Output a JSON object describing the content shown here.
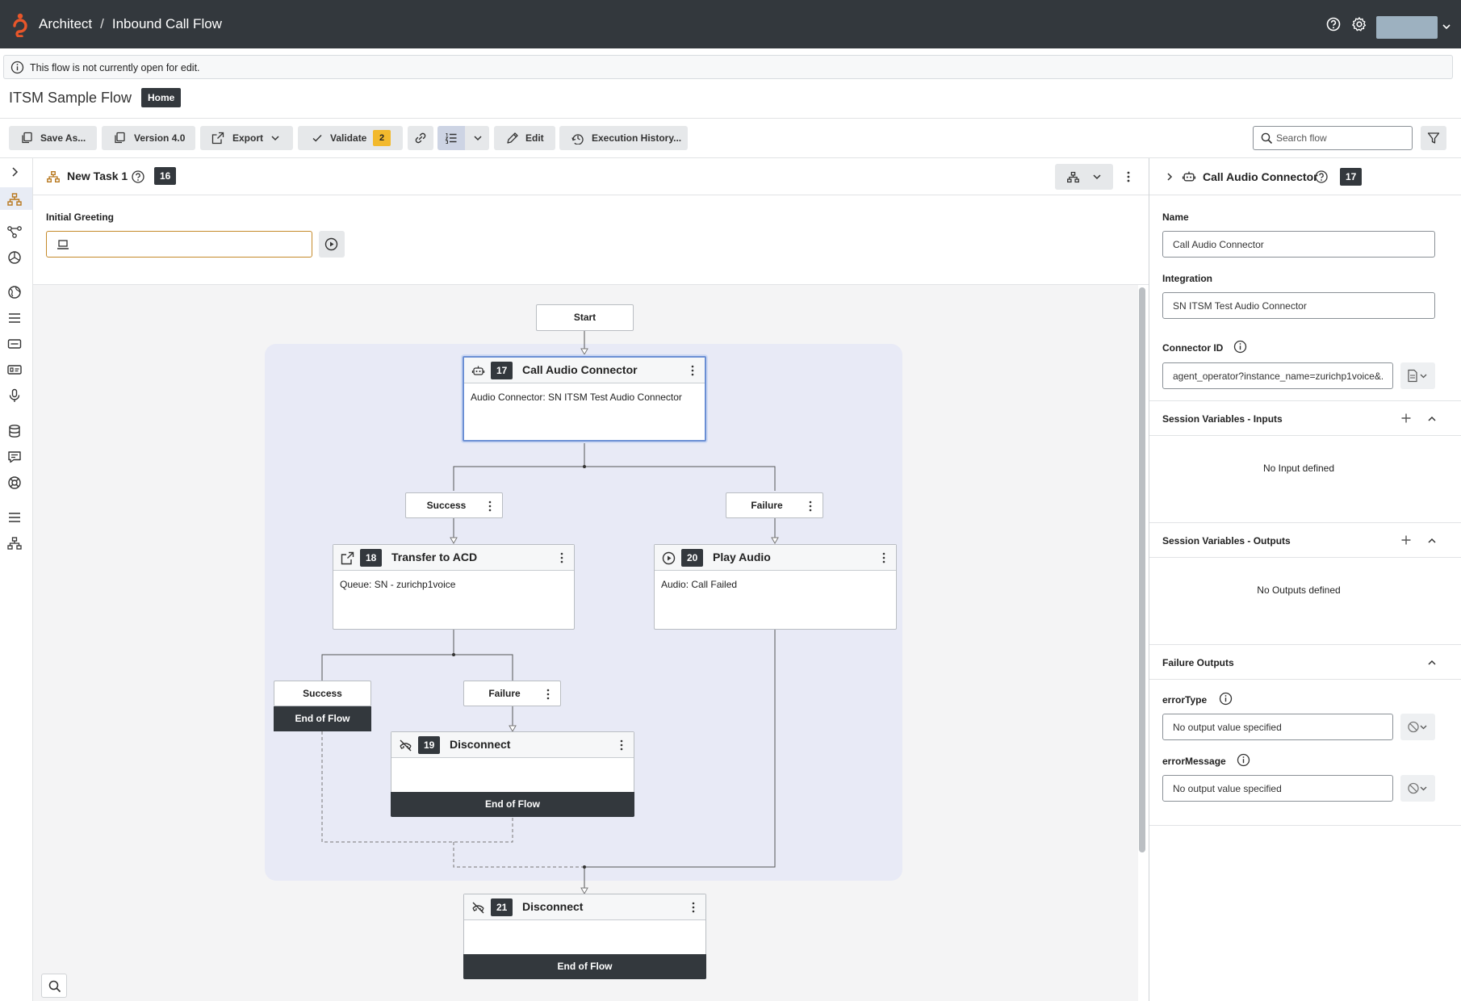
{
  "header": {
    "app": "Architect",
    "separator": "/",
    "page": "Inbound Call Flow"
  },
  "notice": "This flow is not currently open for edit.",
  "flow": {
    "title": "ITSM Sample Flow",
    "badge": "Home"
  },
  "toolbar": {
    "save_as": "Save As...",
    "version": "Version 4.0",
    "export": "Export",
    "validate": "Validate",
    "validate_count": "2",
    "edit": "Edit",
    "execution_history": "Execution History...",
    "search_placeholder": "Search flow"
  },
  "task": {
    "title": "New Task 1",
    "number": "16",
    "greeting_label": "Initial Greeting"
  },
  "canvas": {
    "start": "Start",
    "nodes": {
      "call_audio": {
        "number": "17",
        "title": "Call Audio Connector",
        "body": "Audio Connector: SN ITSM Test Audio Connector"
      },
      "transfer": {
        "number": "18",
        "title": "Transfer to ACD",
        "body": "Queue: SN - zurichp1voice"
      },
      "play_audio": {
        "number": "20",
        "title": "Play Audio",
        "body": "Audio: Call Failed"
      },
      "disconnect_19": {
        "number": "19",
        "title": "Disconnect",
        "footer": "End of Flow"
      },
      "disconnect_21": {
        "number": "21",
        "title": "Disconnect",
        "footer": "End of Flow"
      }
    },
    "paths": {
      "success_1": "Success",
      "failure_1": "Failure",
      "success_2": "Success",
      "success_2_end": "End of Flow",
      "failure_2": "Failure"
    }
  },
  "panel": {
    "title": "Call Audio Connector",
    "number": "17",
    "name_label": "Name",
    "name_value": "Call Audio Connector",
    "integration_label": "Integration",
    "integration_value": "SN ITSM Test Audio Connector",
    "connector_label": "Connector ID",
    "connector_value": "agent_operator?instance_name=zurichp1voice&...",
    "inputs_title": "Session Variables - Inputs",
    "inputs_empty": "No Input defined",
    "outputs_title": "Session Variables - Outputs",
    "outputs_empty": "No Outputs defined",
    "failure_title": "Failure Outputs",
    "error_type_label": "errorType",
    "error_type_value": "No output value specified",
    "error_message_label": "errorMessage",
    "error_message_value": "No output value specified"
  },
  "colors": {
    "header_bg": "#33383d",
    "logo": "#e8562a",
    "validate_badge": "#f2b92d",
    "selection": "#6b8fd4",
    "group_bg": "#e8eaf6"
  }
}
